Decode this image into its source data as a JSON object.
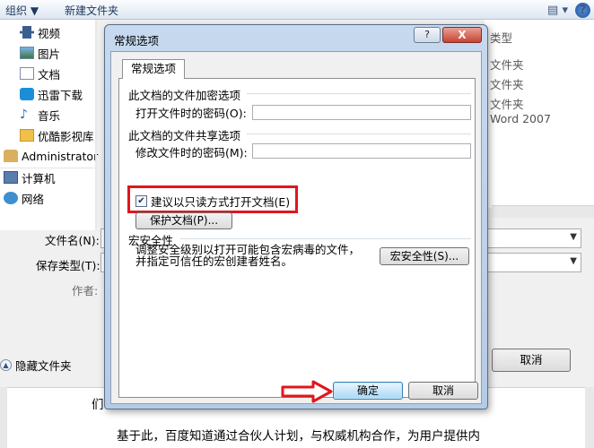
{
  "toolbar": {
    "organize_label": "组织 ▼",
    "new_folder_label": "新建文件夹"
  },
  "nav": {
    "items": [
      {
        "label": "视频",
        "icon": "video-icon"
      },
      {
        "label": "图片",
        "icon": "picture-icon"
      },
      {
        "label": "文档",
        "icon": "document-icon"
      },
      {
        "label": "迅雷下载",
        "icon": "download-icon"
      },
      {
        "label": "音乐",
        "icon": "music-icon"
      },
      {
        "label": "优酷影视库",
        "icon": "folder-icon"
      },
      {
        "label": "Administrator",
        "icon": "user-folder-icon"
      },
      {
        "label": "计算机",
        "icon": "computer-icon"
      },
      {
        "label": "网络",
        "icon": "network-icon"
      }
    ]
  },
  "file_list": {
    "type_header": "类型",
    "types": [
      "文件夹",
      "文件夹",
      "文件夹",
      "Word 2007"
    ]
  },
  "save_form": {
    "filename_label": "文件名(N):",
    "filetype_label": "保存类型(T):",
    "author_label": "作者:"
  },
  "footer": {
    "hide_folders_label": "隐藏文件夹",
    "cancel_label": "取消"
  },
  "dialog": {
    "title": "常规选项",
    "help_label": "?",
    "close_label": "X",
    "tab_label": "常规选项",
    "encrypt_section": "此文档的文件加密选项",
    "open_password_label": "打开文件时的密码(O):",
    "share_section": "此文档的文件共享选项",
    "modify_password_label": "修改文件时的密码(M):",
    "readonly_label": "建议以只读方式打开文档(E)",
    "readonly_checked": true,
    "protect_label": "保护文档(P)...",
    "macro_section": "宏安全性",
    "macro_desc": "调整安全级别以打开可能包含宏病毒的文件，并指定可信任的宏创建者姓名。",
    "macro_button": "宏安全性(S)...",
    "ok_label": "确定",
    "cancel_label": "取消"
  },
  "document": {
    "partial_line": "们",
    "line": "基于此，百度知道通过合伙人计划，与权威机构合作，为用户提供内"
  },
  "colors": {
    "highlight": "#e0161e",
    "title_bar": "#c6d9ef"
  }
}
